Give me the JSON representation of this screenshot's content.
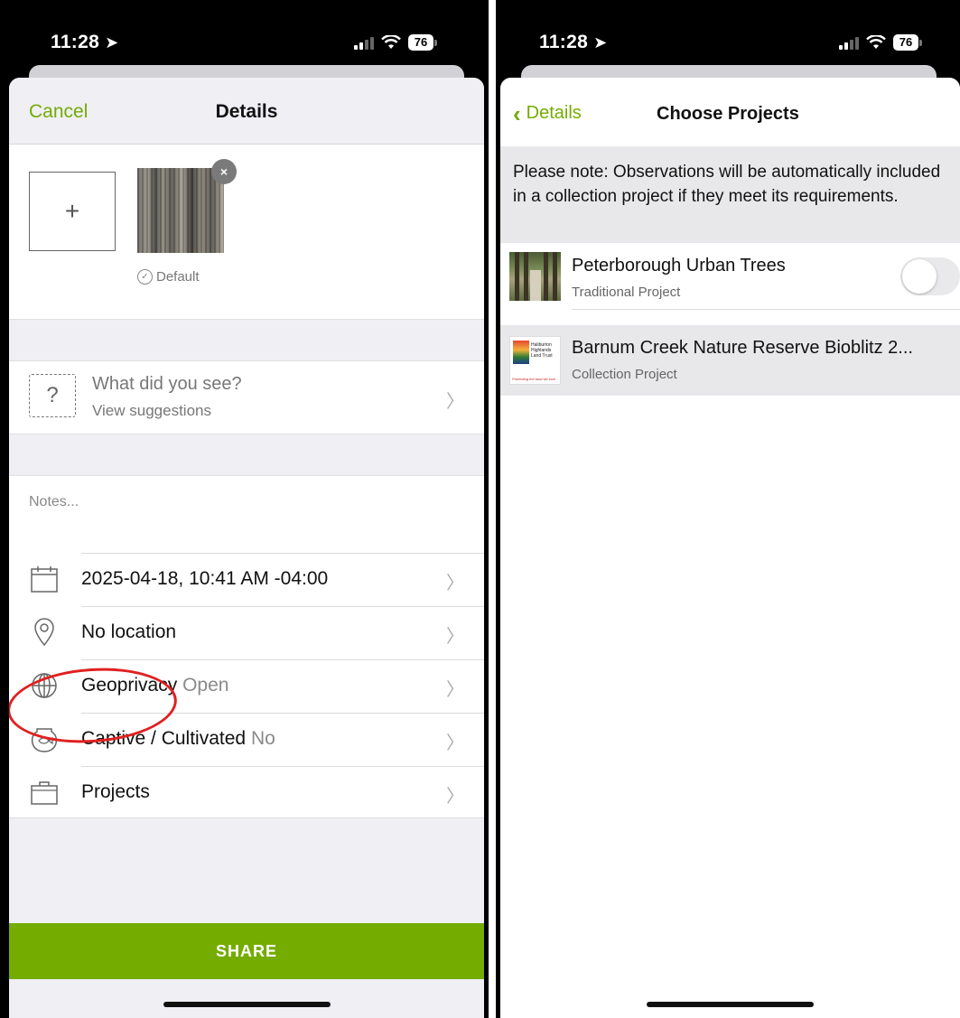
{
  "left": {
    "status": {
      "time": "11:28",
      "battery": "76"
    },
    "nav": {
      "cancel": "Cancel",
      "title": "Details"
    },
    "photos": {
      "add_symbol": "+",
      "remove_symbol": "×",
      "default_label": "Default"
    },
    "identify": {
      "title": "What did you see?",
      "subtitle": "View suggestions"
    },
    "notes_placeholder": "Notes...",
    "rows": [
      {
        "icon": "calendar-icon",
        "label": "2025-04-18, 10:41 AM -04:00",
        "value": ""
      },
      {
        "icon": "location-pin-icon",
        "label": "No location",
        "value": ""
      },
      {
        "icon": "globe-icon",
        "label": "Geoprivacy",
        "value": "Open"
      },
      {
        "icon": "fishbowl-icon",
        "label": "Captive / Cultivated",
        "value": "No"
      },
      {
        "icon": "projects-icon",
        "label": "Projects",
        "value": ""
      }
    ],
    "share": "SHARE",
    "accent": "#74ac00",
    "annotation_color": "#e02020"
  },
  "right": {
    "status": {
      "time": "11:28",
      "battery": "76"
    },
    "nav": {
      "back": "Details",
      "title": "Choose Projects"
    },
    "note": "Please note: Observations will be automatically included in a collection project if they meet its requirements.",
    "projects": [
      {
        "name": "Peterborough Urban Trees",
        "type": "Traditional Project",
        "toggle_on": false
      },
      {
        "name": "Barnum Creek Nature Reserve Bioblitz 2...",
        "type": "Collection Project"
      }
    ],
    "logo_text": "Haliburton Highlands Land Trust",
    "logo_tagline": "Protecting the land we love"
  }
}
